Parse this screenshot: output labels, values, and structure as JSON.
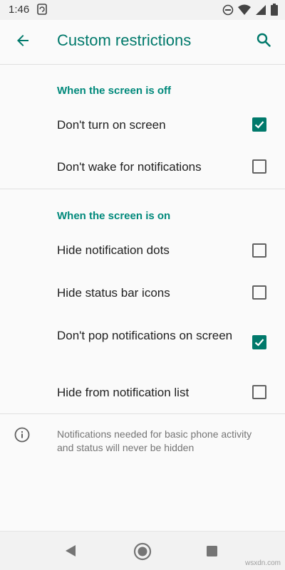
{
  "status_bar": {
    "time": "1:46",
    "icons": [
      "sync-icon",
      "do-not-disturb-icon",
      "wifi-icon",
      "signal-icon",
      "battery-icon"
    ]
  },
  "app_bar": {
    "title": "Custom restrictions",
    "back_icon": "arrow-back-icon",
    "search_icon": "search-icon"
  },
  "sections": [
    {
      "header": "When the screen is off",
      "items": [
        {
          "label": "Don't turn on screen",
          "checked": true
        },
        {
          "label": "Don't wake for notifications",
          "checked": false
        }
      ]
    },
    {
      "header": "When the screen is on",
      "items": [
        {
          "label": "Hide notification dots",
          "checked": false
        },
        {
          "label": "Hide status bar icons",
          "checked": false
        },
        {
          "label": "Don't pop notifications on screen",
          "checked": true
        },
        {
          "label": "Hide from notification list",
          "checked": false
        }
      ]
    }
  ],
  "footer_info": {
    "icon": "info-icon",
    "text": "Notifications needed for basic phone activity and status will never be hidden"
  },
  "nav_bar": {
    "back_icon": "nav-back-icon",
    "home_icon": "nav-home-icon",
    "recents_icon": "nav-recents-icon"
  },
  "watermark": "wsxdn.com",
  "colors": {
    "accent": "#00796b",
    "section_header": "#00897b",
    "background": "#fafafa"
  }
}
